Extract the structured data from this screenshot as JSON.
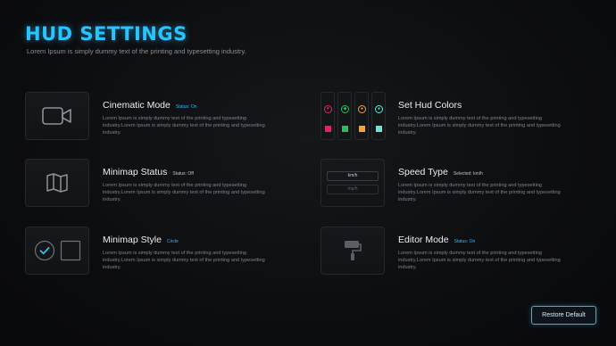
{
  "header": {
    "title": "HUD SETTINGS",
    "subtitle": "Lorem Ipsum is simply dummy text of the printing and typesetting industry."
  },
  "settings": [
    {
      "name": "Cinematic Mode",
      "status": "Status: On",
      "description": "Lorem Ipsum is simply dummy text of the printing and typesetting industry.Lorem Ipsum is simply dummy text of the printing and typesetting industry.",
      "icon": "video-camera-icon"
    },
    {
      "name": "Set Hud Colors",
      "status": "",
      "description": "Lorem Ipsum is simply dummy text of the printing and typesetting industry.Lorem Ipsum is simply dummy text of the printing and typesetting industry.",
      "colors": [
        {
          "icon": "heart-icon",
          "glyph": "♥",
          "color": "#e0245e"
        },
        {
          "icon": "shield-icon",
          "glyph": "◆",
          "color": "#21c05a"
        },
        {
          "icon": "food-icon",
          "glyph": "●",
          "color": "#f2a33a"
        },
        {
          "icon": "water-drop-icon",
          "glyph": "●",
          "color": "#62e8d6"
        }
      ]
    },
    {
      "name": "Minimap Status",
      "status": "Status: Off",
      "description": "Lorem Ipsum is simply dummy text of the printing and typesetting industry.Lorem Ipsum is simply dummy text of the printing and typesetting industry.",
      "icon": "folded-map-icon"
    },
    {
      "name": "Speed Type",
      "status": "Selected: km/h",
      "description": "Lorem Ipsum is simply dummy text of the printing and typesetting industry.Lorem Ipsum is simply dummy text of the printing and typesetting industry.",
      "options": [
        "km/h",
        "mp/h"
      ]
    },
    {
      "name": "Minimap Style",
      "status": "Circle",
      "description": "Lorem Ipsum is simply dummy text of the printing and typesetting industry.Lorem Ipsum is simply dummy text of the printing and typesetting industry.",
      "icon": "checkmark-icon"
    },
    {
      "name": "Editor Mode",
      "status": "Status: On",
      "description": "Lorem Ipsum is simply dummy text of the printing and typesetting industry.Lorem Ipsum is simply dummy text of the printing and typesetting industry.",
      "icon": "paint-roller-icon"
    }
  ],
  "footer": {
    "restore_label": "Restore Default"
  },
  "colors": {
    "accent": "#29c4ff",
    "background": "#0c0d0f"
  }
}
